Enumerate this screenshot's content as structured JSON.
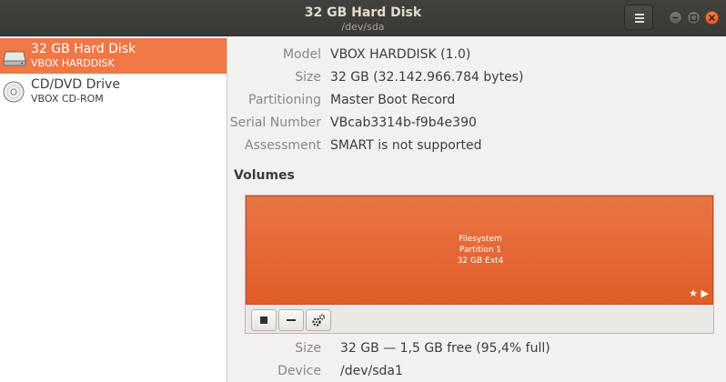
{
  "window": {
    "title": "32 GB Hard Disk",
    "subtitle": "/dev/sda"
  },
  "sidebar": {
    "devices": [
      {
        "name": "32 GB Hard Disk",
        "model": "VBOX HARDDISK",
        "icon": "hard-disk-icon",
        "selected": true
      },
      {
        "name": "CD/DVD Drive",
        "model": "VBOX CD-ROM",
        "icon": "optical-disc-icon",
        "selected": false
      }
    ]
  },
  "drive": {
    "model_label": "Model",
    "model": "VBOX HARDDISK (1.0)",
    "size_label": "Size",
    "size": "32 GB (32.142.966.784 bytes)",
    "partitioning_label": "Partitioning",
    "partitioning": "Master Boot Record",
    "serial_label": "Serial Number",
    "serial": "VBcab3314b-f9b4e390",
    "assessment_label": "Assessment",
    "assessment": "SMART is not supported"
  },
  "volumes": {
    "title": "Volumes",
    "partition": {
      "line1": "Filesystem",
      "line2": "Partition 1",
      "line3": "32 GB Ext4",
      "color": "#e4632c"
    },
    "toolbar": [
      "stop-icon",
      "minus-icon",
      "gears-icon"
    ],
    "size_label": "Size",
    "size": "32 GB — 1,5 GB free (95,4% full)",
    "device_label": "Device",
    "device": "/dev/sda1"
  },
  "colors": {
    "accent": "#f07746",
    "headerbar": "#3e3d39"
  }
}
